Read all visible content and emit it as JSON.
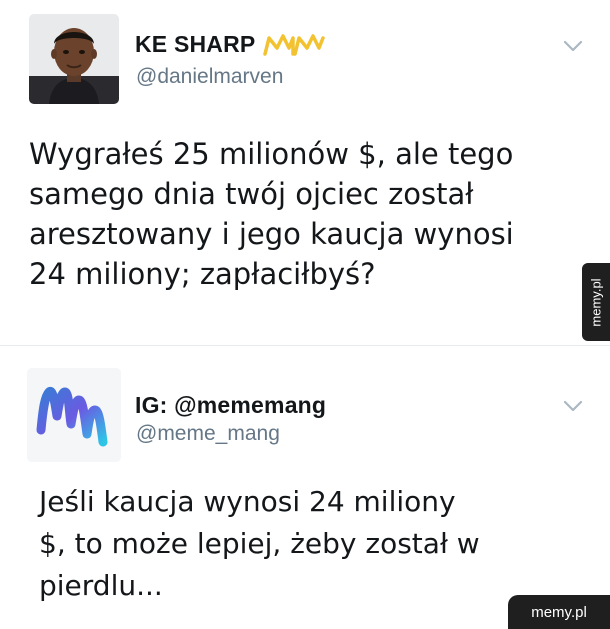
{
  "tweets": [
    {
      "display_name": "KE SHARP",
      "handle": "@danielmarven",
      "text": "Wygrałeś 25 milionów $, ale tego\nsamego dnia twój ojciec został\naresztowany i jego kaucja wynosi\n24 miliony; zapłaciłbyś?",
      "name_emoji": "crown-emoji",
      "avatar": "profile-photo"
    },
    {
      "display_name": "IG: @mememang",
      "handle": "@meme_mang",
      "text": "Jeśli kaucja wynosi 24 miliony\n$, to może lepiej, żeby został w\npierdlu...",
      "avatar": "mm-logo"
    }
  ],
  "watermarks": {
    "side": "memy.pl",
    "corner": "memy.pl"
  },
  "colors": {
    "text": "#14171a",
    "handle": "#657786",
    "chevron": "#aab8c2",
    "watermark_bg": "#1f1f1f",
    "crown": "#f2c230"
  }
}
